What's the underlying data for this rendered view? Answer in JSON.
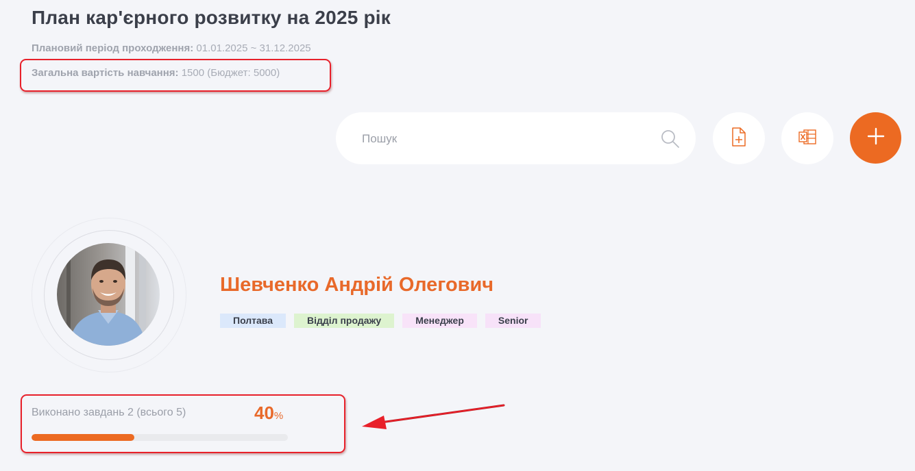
{
  "header": {
    "title": "План кар'єрного розвитку на 2025 рік",
    "period_label": "Плановий період проходження:",
    "period_value": "01.01.2025 ~ 31.12.2025",
    "cost_label": "Загальна вартість навчання:",
    "cost_value": "1500 (Бюджет: 5000)"
  },
  "toolbar": {
    "search_placeholder": "Пошук",
    "icons": [
      "search-icon",
      "file-add-icon",
      "excel-icon",
      "plus-icon"
    ],
    "accent_color": "#ec6a22"
  },
  "employee": {
    "name": "Шевченко Андрій Олегович",
    "tags": [
      "Полтава",
      "Відділ продажу",
      "Менеджер",
      "Senior"
    ]
  },
  "progress": {
    "label": "Виконано завдань 2 (всього 5)",
    "percent_value": "40",
    "percent_sign": "%",
    "fraction": 0.4
  },
  "annotations": {
    "highlight_color": "#e8202a"
  }
}
